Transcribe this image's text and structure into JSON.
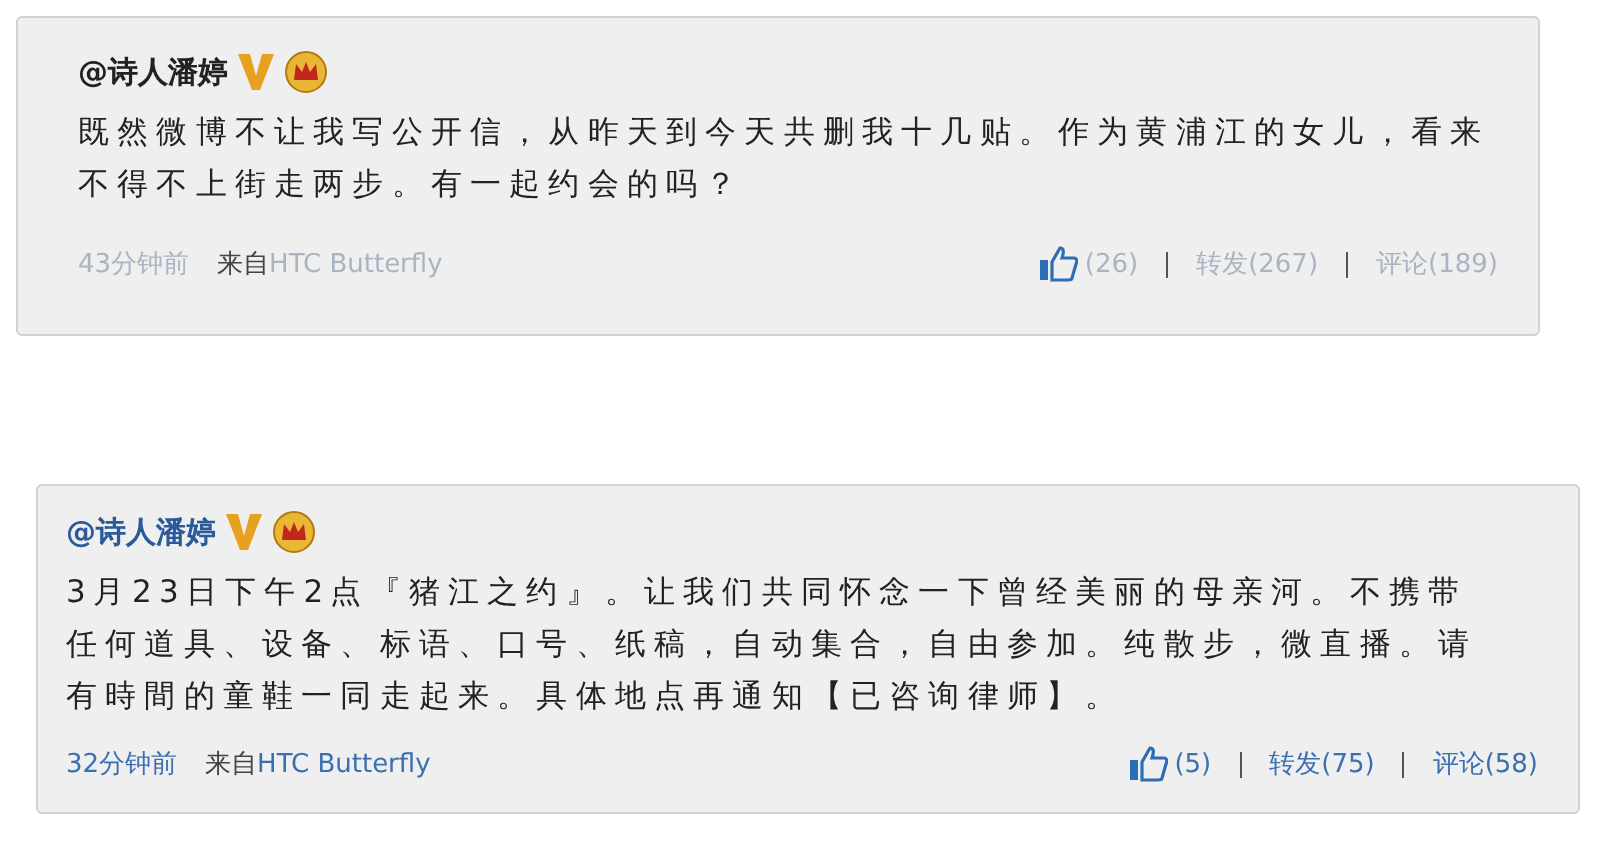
{
  "posts": [
    {
      "author": "@诗人潘婷",
      "dimmed": true,
      "text": "既然微博不让我写公开信，从昨天到今天共删我十几贴。作为黄浦江的女儿，看来不得不上街走两步。有一起约会的吗？",
      "time": "43分钟前",
      "source_prefix": "来自",
      "source": "HTC Butterfly",
      "likes": "(26)",
      "repost": "转发(267)",
      "comment": "评论(189)"
    },
    {
      "author": "@诗人潘婷",
      "dimmed": false,
      "text": "3月23日下午2点『猪江之约』。让我们共同怀念一下曾经美丽的母亲河。不携带任何道具、设备、标语、口号、纸稿，自动集合，自由参加。纯散步，微直播。请有時間的童鞋一同走起来。具体地点再通知【已咨询律师】。",
      "time": "32分钟前",
      "source_prefix": "来自",
      "source": "HTC Butterfly",
      "likes": "(5)",
      "repost": "转发(75)",
      "comment": "评论(58)"
    }
  ]
}
